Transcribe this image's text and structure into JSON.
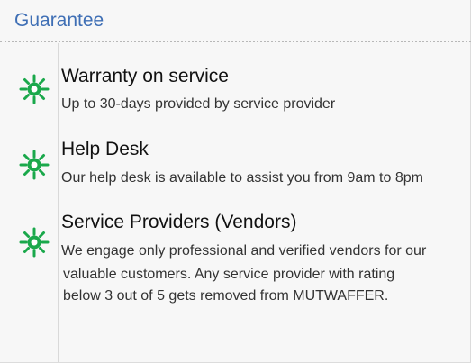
{
  "section": {
    "title": "Guarantee"
  },
  "items": [
    {
      "title": "Warranty on service",
      "description_lines": [
        "Up to 30-days provided by service provider"
      ],
      "icon": "sun-badge-icon"
    },
    {
      "title": "Help Desk",
      "description_lines": [
        "Our help desk is available to assist you from 9am to 8pm"
      ],
      "icon": "sun-badge-icon"
    },
    {
      "title": "Service Providers (Vendors)",
      "description_lines": [
        "We engage only professional and verified vendors for our",
        "valuable customers. Any service provider with rating",
        "below 3 out of 5 gets removed from MUTWAFFER."
      ],
      "icon": "sun-badge-icon"
    }
  ],
  "colors": {
    "title": "#3f6fb5",
    "icon": "#1aa84b"
  }
}
